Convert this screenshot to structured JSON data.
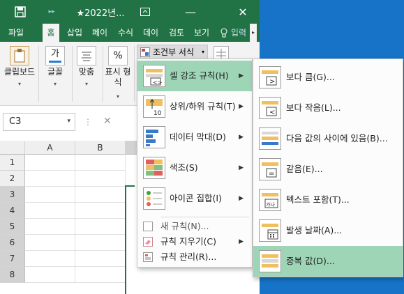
{
  "window": {
    "title": "★2022년...",
    "save_icon": "save-icon",
    "close_glyph": "✕",
    "restore_glyph": "⧉"
  },
  "tabs": [
    {
      "label": "파일"
    },
    {
      "label": "홈"
    },
    {
      "label": "삽입"
    },
    {
      "label": "페이"
    },
    {
      "label": "수식"
    },
    {
      "label": "데이"
    },
    {
      "label": "검토"
    },
    {
      "label": "보기"
    },
    {
      "label": "입력"
    }
  ],
  "ribbon": {
    "clipboard": "클립보드",
    "font": "글꼴",
    "font_glyph": "가",
    "align": "맞춤",
    "number": "표시 형식",
    "number_line1": "표시 형",
    "number_line2": "식",
    "number_glyph": "%",
    "cond_format": "조건부 서식"
  },
  "formula_bar": {
    "name_box": "C3",
    "cancel_glyph": "✕"
  },
  "sheet": {
    "columns": [
      "A",
      "B"
    ],
    "rows": [
      "1",
      "2",
      "3",
      "4",
      "5",
      "6",
      "7",
      "8"
    ]
  },
  "cond_menu": {
    "items": [
      {
        "label": "셀 강조 규칙(H)",
        "has_sub": true
      },
      {
        "label": "상위/하위 규칙(T)",
        "has_sub": true
      },
      {
        "label": "데이터 막대(D)",
        "has_sub": true
      },
      {
        "label": "색조(S)",
        "has_sub": true
      },
      {
        "label": "아이콘 집합(I)",
        "has_sub": true
      }
    ],
    "small_items": [
      {
        "label": "새 규칙(N)..."
      },
      {
        "label": "규칙 지우기(C)"
      },
      {
        "label": "규칙 관리(R)..."
      }
    ],
    "top10_label": "10"
  },
  "sub_menu": {
    "items": [
      {
        "label": "보다 큼(G)..."
      },
      {
        "label": "보다 작음(L)..."
      },
      {
        "label": "다음 값의 사이에 있음(B)..."
      },
      {
        "label": "같음(E)..."
      },
      {
        "label": "텍스트 포함(T)..."
      },
      {
        "label": "발생 날짜(A)..."
      },
      {
        "label": "중복 값(D)..."
      }
    ],
    "text_icon_label": "가나"
  },
  "colors": {
    "excel_green": "#217346",
    "highlight": "#9fd5b7",
    "desktop_blue": "#1673c7"
  }
}
